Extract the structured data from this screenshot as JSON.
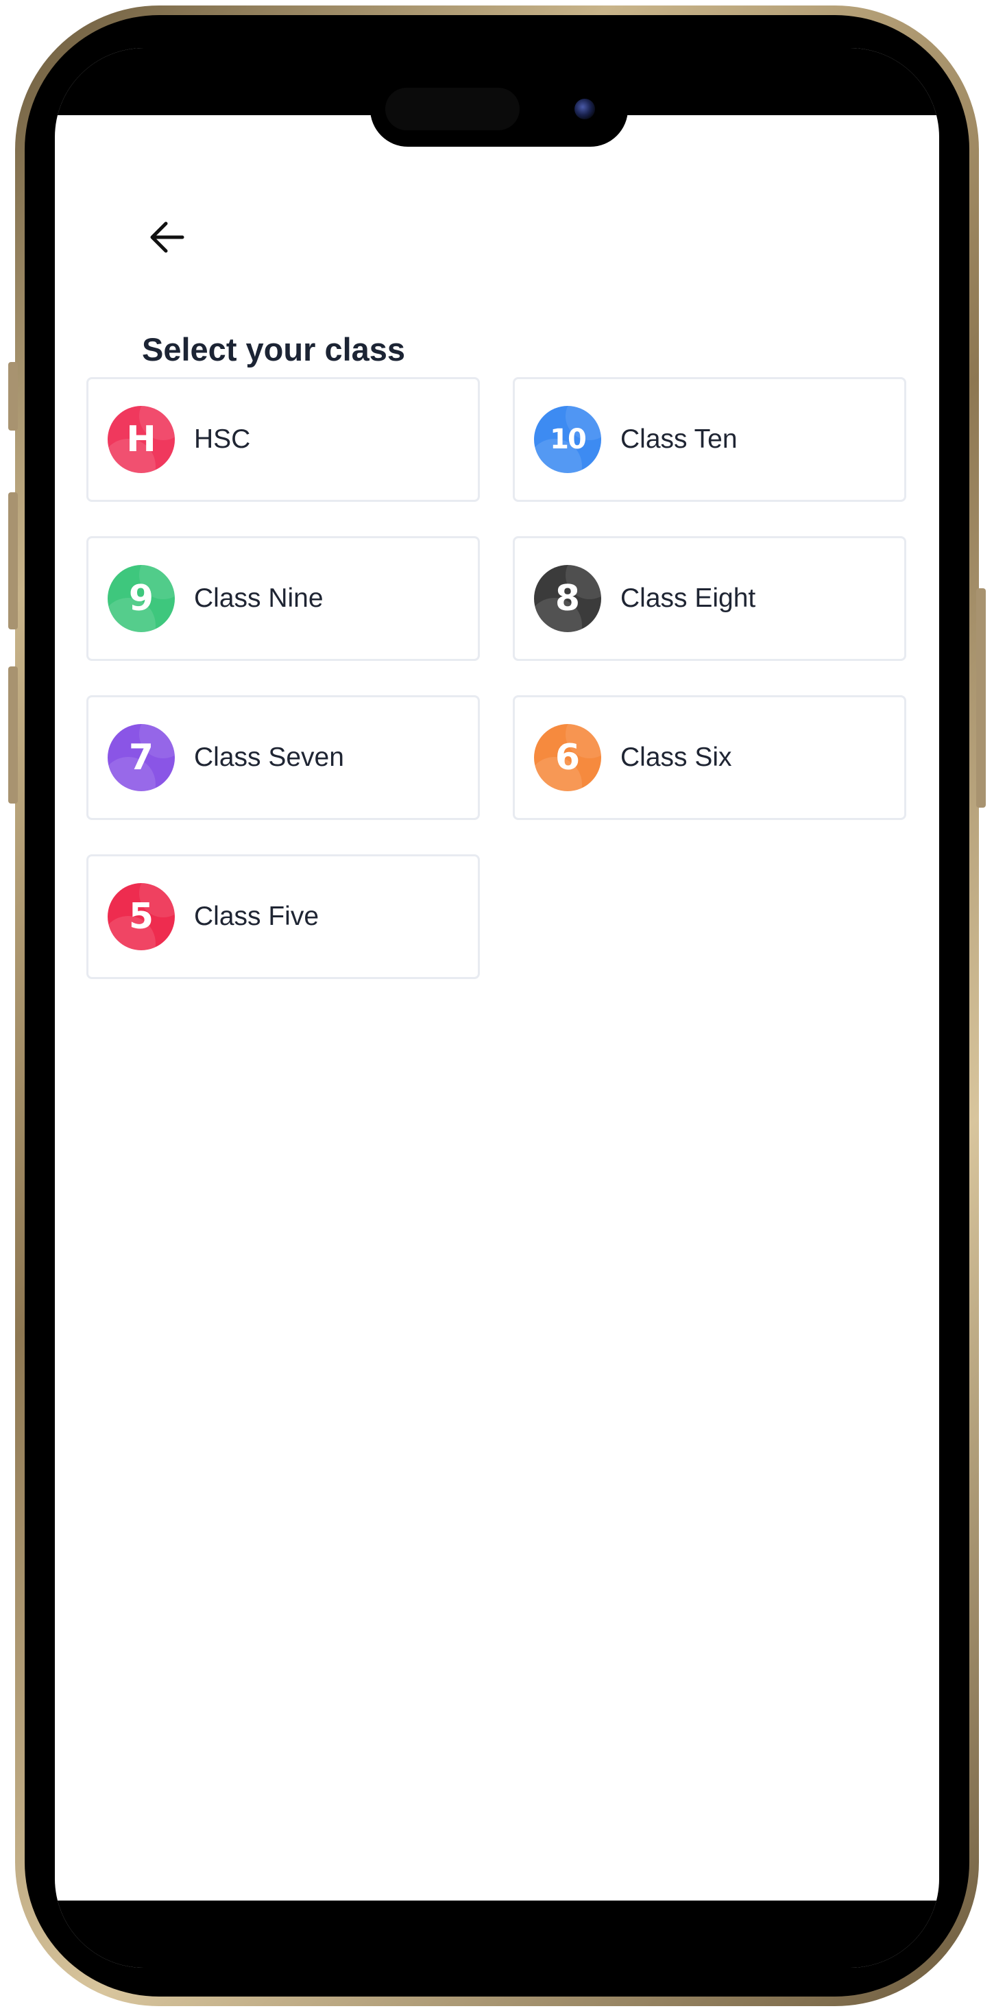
{
  "page": {
    "title": "Select your class"
  },
  "classes": [
    {
      "label": "HSC",
      "badge": "H",
      "color": "#f0385d"
    },
    {
      "label": "Class Ten",
      "badge": "10",
      "color": "#3d8bf2"
    },
    {
      "label": "Class Nine",
      "badge": "9",
      "color": "#3ec77d"
    },
    {
      "label": "Class Eight",
      "badge": "8",
      "color": "#3b3b3b"
    },
    {
      "label": "Class Seven",
      "badge": "7",
      "color": "#8a55e6"
    },
    {
      "label": "Class Six",
      "badge": "6",
      "color": "#f68a3e"
    },
    {
      "label": "Class Five",
      "badge": "5",
      "color": "#ee2c4f"
    }
  ]
}
